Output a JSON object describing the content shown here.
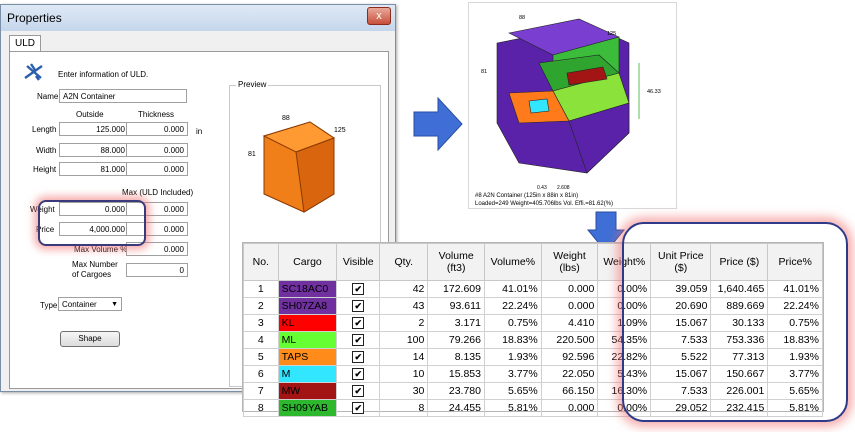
{
  "dialog": {
    "title": "Properties",
    "close_glyph": "x",
    "tab": "ULD",
    "instruction": "Enter information of ULD.",
    "name_label": "Name",
    "name_value": "A2N Container",
    "col_outside": "Outside",
    "col_thickness": "Thickness",
    "unit": "in",
    "length_label": "Length",
    "length_value": "125.000",
    "length_thick": "0.000",
    "width_label": "Width",
    "width_value": "88.000",
    "width_thick": "0.000",
    "height_label": "Height",
    "height_value": "81.000",
    "height_thick": "0.000",
    "max_label": "Max (ULD Included)",
    "weight_label": "Weight",
    "weight_value": "0.000",
    "weight_thick": "0.000",
    "price_label": "Price",
    "price_value": "4,000.000",
    "price_thick": "0.000",
    "max_volume_label": "Max Volume %",
    "max_volume_value": "0.000",
    "max_cargoes_label": "Max Number of Cargoes",
    "max_cargoes_value": "0",
    "type_label": "Type",
    "type_value": "Container",
    "shape_button": "Shape",
    "preview_label": "Preview",
    "preview_dims": {
      "a": "88",
      "b": "125",
      "c": "81"
    }
  },
  "view3d": {
    "dims": {
      "top": "88",
      "right_top": "125",
      "left": "81",
      "right": "46.33",
      "bottom_a": "0.43",
      "bottom_b": "2.608"
    },
    "caption1": "#8 A2N Container (125in x 88in x 81in)",
    "caption2": "Loaded=249 Weight=405.706lbs Vol. Effi.=81.62(%)"
  },
  "table": {
    "headers": [
      "No.",
      "Cargo",
      "Visible",
      "Qty.",
      "Volume (ft3)",
      "Volume%",
      "Weight (lbs)",
      "Weight%",
      "Unit Price ($)",
      "Price ($)",
      "Price%"
    ],
    "rows": [
      {
        "no": "1",
        "cargo": "SC18AC0",
        "color": "#7030a0",
        "qty": "42",
        "vol": "172.609",
        "volp": "41.01%",
        "wt": "0.000",
        "wtp": "0.00%",
        "unit": "39.059",
        "price": "1,640.465",
        "pricep": "41.01%"
      },
      {
        "no": "2",
        "cargo": "SH07ZA8",
        "color": "#7030a0",
        "qty": "43",
        "vol": "93.611",
        "volp": "22.24%",
        "wt": "0.000",
        "wtp": "0.00%",
        "unit": "20.690",
        "price": "889.669",
        "pricep": "22.24%"
      },
      {
        "no": "3",
        "cargo": "KL",
        "color": "#ff0000",
        "qty": "2",
        "vol": "3.171",
        "volp": "0.75%",
        "wt": "4.410",
        "wtp": "1.09%",
        "unit": "15.067",
        "price": "30.133",
        "pricep": "0.75%"
      },
      {
        "no": "4",
        "cargo": "ML",
        "color": "#66ff33",
        "qty": "100",
        "vol": "79.266",
        "volp": "18.83%",
        "wt": "220.500",
        "wtp": "54.35%",
        "unit": "7.533",
        "price": "753.336",
        "pricep": "18.83%"
      },
      {
        "no": "5",
        "cargo": "TAPS",
        "color": "#ff8c1a",
        "qty": "14",
        "vol": "8.135",
        "volp": "1.93%",
        "wt": "92.596",
        "wtp": "22.82%",
        "unit": "5.522",
        "price": "77.313",
        "pricep": "1.93%"
      },
      {
        "no": "6",
        "cargo": "M",
        "color": "#33e6ff",
        "qty": "10",
        "vol": "15.853",
        "volp": "3.77%",
        "wt": "22.050",
        "wtp": "5.43%",
        "unit": "15.067",
        "price": "150.667",
        "pricep": "3.77%"
      },
      {
        "no": "7",
        "cargo": "MW",
        "color": "#a31515",
        "qty": "30",
        "vol": "23.780",
        "volp": "5.65%",
        "wt": "66.150",
        "wtp": "16.30%",
        "unit": "7.533",
        "price": "226.001",
        "pricep": "5.65%"
      },
      {
        "no": "8",
        "cargo": "SH09YAB",
        "color": "#2db82d",
        "qty": "8",
        "vol": "24.455",
        "volp": "5.81%",
        "wt": "0.000",
        "wtp": "0.00%",
        "unit": "29.052",
        "price": "232.415",
        "pricep": "5.81%"
      }
    ]
  },
  "colors": {
    "arrow": "#3f6fd6",
    "highlight": "#2e3a87"
  }
}
